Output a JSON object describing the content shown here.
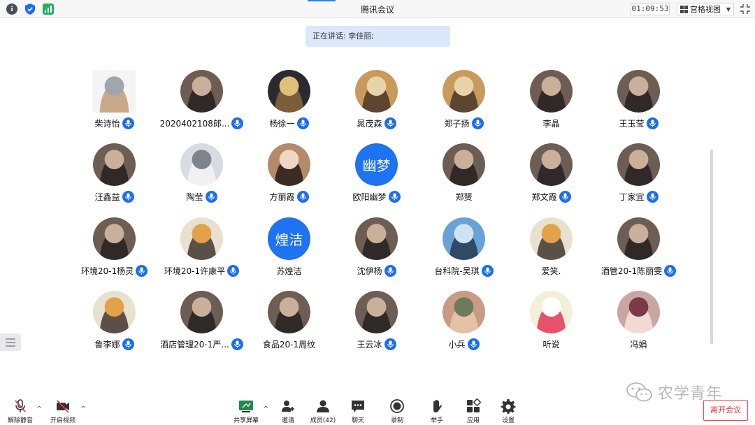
{
  "window": {
    "title": "腾讯会议",
    "timer": "01:09:53",
    "view_mode": "宫格视图"
  },
  "banner": {
    "speaking": "正在讲话: 李佳丽;"
  },
  "participants": [
    {
      "name": "柴诗怡",
      "mic": true,
      "avatar": "cat-laptop-avatar"
    },
    {
      "name": "2020402108郎...",
      "mic": true,
      "avatar": "photo-avatar"
    },
    {
      "name": "杨徐一",
      "mic": true,
      "avatar": "anime-avatar"
    },
    {
      "name": "晁茂森",
      "mic": true,
      "avatar": "dog-avatar"
    },
    {
      "name": "郑子扬",
      "mic": true,
      "avatar": "dog-avatar"
    },
    {
      "name": "李晶",
      "mic": false,
      "avatar": "photo-avatar"
    },
    {
      "name": "王玉莹",
      "mic": true,
      "avatar": "photo-avatar"
    },
    {
      "name": "汪鑫益",
      "mic": true,
      "avatar": "photo-avatar"
    },
    {
      "name": "陶莹",
      "mic": true,
      "avatar": "sketch-avatar"
    },
    {
      "name": "方丽霞",
      "mic": true,
      "avatar": "baby-avatar"
    },
    {
      "name": "欧阳幽梦",
      "mic": true,
      "avatar_text": "幽梦"
    },
    {
      "name": "郑赟",
      "mic": false,
      "avatar": "photo-avatar"
    },
    {
      "name": "郑文霞",
      "mic": true,
      "avatar": "photo-avatar"
    },
    {
      "name": "丁家宜",
      "mic": true,
      "avatar": "photo-avatar"
    },
    {
      "name": "环境20-1杨灵",
      "mic": true,
      "avatar": "photo-avatar"
    },
    {
      "name": "环境20-1许康平",
      "mic": true,
      "avatar": "cartoon-avatar"
    },
    {
      "name": "苏煌洁",
      "mic": false,
      "avatar_text": "煌洁"
    },
    {
      "name": "沈伊杨",
      "mic": true,
      "avatar": "photo-avatar"
    },
    {
      "name": "台科院-吴琪",
      "mic": true,
      "avatar": "sky-avatar"
    },
    {
      "name": "爱笑.",
      "mic": false,
      "avatar": "cartoon-avatar"
    },
    {
      "name": "酒管20-1陈丽雯",
      "mic": true,
      "avatar": "photo-avatar"
    },
    {
      "name": "鲁李娜",
      "mic": true,
      "avatar": "cartoon-avatar"
    },
    {
      "name": "酒店管理20-1严...",
      "mic": true,
      "avatar": "photo-avatar"
    },
    {
      "name": "食品20-1周纹",
      "mic": false,
      "avatar": "photo-avatar"
    },
    {
      "name": "王云冰",
      "mic": true,
      "avatar": "photo-avatar"
    },
    {
      "name": "小兵",
      "mic": true,
      "avatar": "sunset-avatar"
    },
    {
      "name": "听说",
      "mic": false,
      "avatar": "hello-kitty-avatar"
    },
    {
      "name": "冯娟",
      "mic": false,
      "avatar": "doll-avatar"
    }
  ],
  "toolbar": {
    "unmute": "解除静音",
    "start_video": "开启视频",
    "share_screen": "共享屏幕",
    "invite": "邀请",
    "members": "成员(42)",
    "chat": "聊天",
    "record": "录制",
    "raise_hand": "举手",
    "apps": "应用",
    "settings": "设置",
    "leave": "离开会议"
  },
  "watermark": "农学青年"
}
